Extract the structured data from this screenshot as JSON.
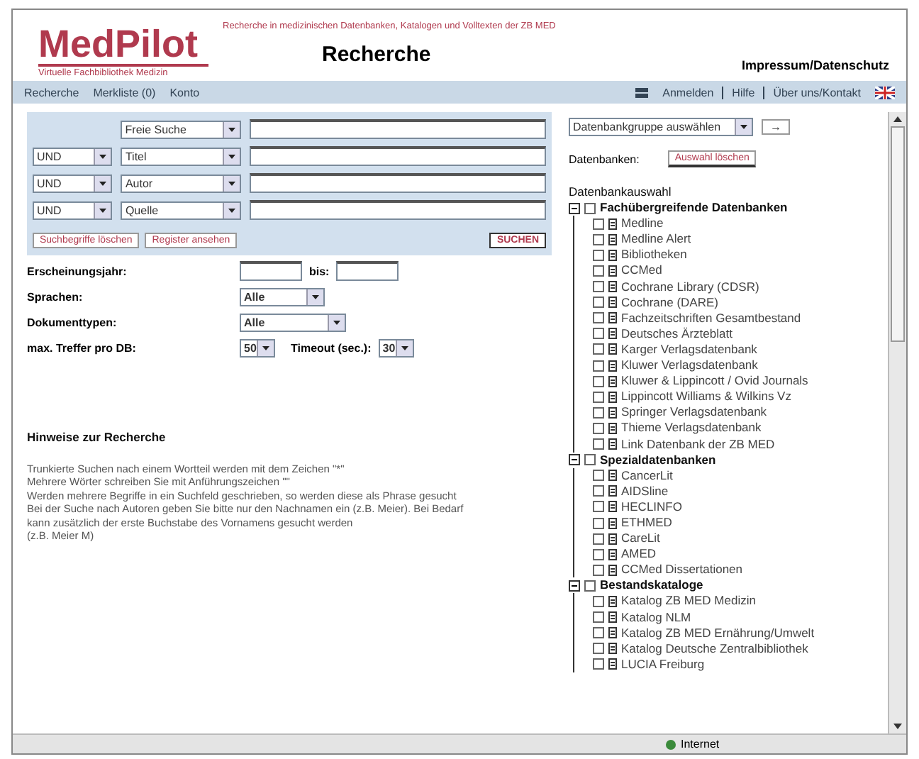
{
  "header": {
    "logo": "MedPilot",
    "logo_subtitle": "Virtuelle Fachbibliothek Medizin",
    "tagline": "Recherche in medizinischen Datenbanken, Katalogen und Volltexten der ZB MED",
    "page_title": "Recherche",
    "link": "Impressum/Datenschutz"
  },
  "nav": {
    "items": [
      "Recherche",
      "Merkliste (0)",
      "Konto"
    ],
    "right_items": [
      "Anmelden",
      "Hilfe",
      "Über uns/Kontakt"
    ]
  },
  "search": {
    "rows": [
      {
        "operator": null,
        "field": "Freie Suche"
      },
      {
        "operator": "UND",
        "field": "Titel"
      },
      {
        "operator": "UND",
        "field": "Autor"
      },
      {
        "operator": "UND",
        "field": "Quelle"
      }
    ],
    "buttons": [
      "Suchbegriffe löschen",
      "Register ansehen"
    ],
    "submit": "SUCHEN"
  },
  "filters": [
    {
      "kind": "range",
      "label": "Erscheinungsjahr:",
      "between": "bis:"
    },
    {
      "kind": "select",
      "label": "Sprachen:",
      "value": "Alle"
    },
    {
      "kind": "select",
      "label": "Dokumenttypen:",
      "value": "Alle"
    },
    {
      "kind": "pair",
      "label": "max. Treffer pro DB:",
      "value": "50",
      "label2": "Timeout (sec.):",
      "value2": "30"
    }
  ],
  "help": {
    "title": "Hinweise zur Recherche",
    "lines": [
      "Trunkierte Suchen nach einem Wortteil werden mit dem Zeichen \"*\"",
      "Mehrere Wörter schreiben Sie mit Anführungszeichen \"\"",
      "Werden mehrere Begriffe in ein Suchfeld geschrieben, so werden diese als Phrase gesucht",
      "Bei der Suche nach Autoren geben Sie bitte nur den Nachnamen ein (z.B. Meier). Bei Bedarf",
      "kann zusätzlich der erste Buchstabe des Vornamens gesucht werden",
      "(z.B. Meier M)"
    ]
  },
  "databases": {
    "select": "Datenbankgruppe auswählen",
    "go": "→",
    "label": "Datenbanken:",
    "clear": "Auswahl löschen",
    "tree_title": "Datenbankauswahl",
    "groups": [
      {
        "label": "Fachübergreifende Datenbanken",
        "expanded": true,
        "checked": false,
        "children": [
          {
            "label": "Medline",
            "checked": false
          },
          {
            "label": "Medline Alert",
            "checked": false
          },
          {
            "label": "Bibliotheken",
            "checked": false
          },
          {
            "label": "CCMed",
            "checked": false
          },
          {
            "label": "Cochrane Library (CDSR)",
            "checked": false
          },
          {
            "label": "Cochrane (DARE)",
            "checked": false
          },
          {
            "label": "Fachzeitschriften Gesamtbestand",
            "checked": false
          },
          {
            "label": "Deutsches Ärzteblatt",
            "checked": false
          },
          {
            "label": "Karger Verlagsdatenbank",
            "checked": false
          },
          {
            "label": "Kluwer Verlagsdatenbank",
            "checked": false
          },
          {
            "label": "Kluwer & Lippincott / Ovid Journals",
            "checked": false
          },
          {
            "label": "Lippincott Williams & Wilkins Vz",
            "checked": false
          },
          {
            "label": "Springer Verlagsdatenbank",
            "checked": false
          },
          {
            "label": "Thieme Verlagsdatenbank",
            "checked": false
          },
          {
            "label": "Link Datenbank der ZB MED",
            "checked": false
          }
        ]
      },
      {
        "label": "Spezialdatenbanken",
        "expanded": true,
        "checked": false,
        "children": [
          {
            "label": "CancerLit",
            "checked": false
          },
          {
            "label": "AIDSline",
            "checked": false
          },
          {
            "label": "HECLINFO",
            "checked": false
          },
          {
            "label": "ETHMED",
            "checked": false
          },
          {
            "label": "CareLit",
            "checked": false
          },
          {
            "label": "AMED",
            "checked": false
          },
          {
            "label": "CCMed Dissertationen",
            "checked": false
          }
        ]
      },
      {
        "label": "Bestandskataloge",
        "expanded": true,
        "checked": false,
        "children": [
          {
            "label": "Katalog ZB MED Medizin",
            "checked": false
          },
          {
            "label": "Katalog NLM",
            "checked": false
          },
          {
            "label": "Katalog ZB MED Ernährung/Umwelt",
            "checked": false
          },
          {
            "label": "Katalog Deutsche Zentralbibliothek",
            "checked": false
          },
          {
            "label": "LUCIA Freiburg",
            "checked": false
          }
        ]
      }
    ]
  },
  "status_bar": {
    "zone": "Internet"
  }
}
